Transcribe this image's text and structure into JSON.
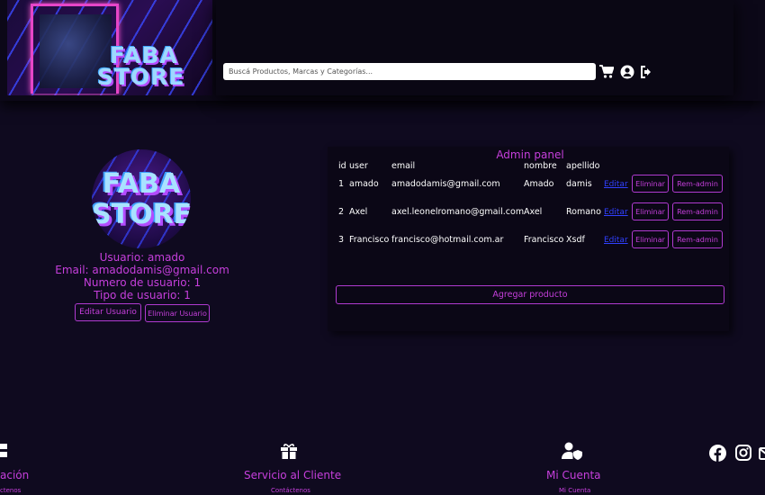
{
  "header": {
    "logo_text_line1": "FABA",
    "logo_text_line2": "STORE",
    "search_placeholder": "Buscá Productos, Marcas y Categorías...",
    "icons": [
      "cart-icon",
      "user-circle-icon",
      "logout-icon"
    ]
  },
  "profile": {
    "avatar_text_line1": "FABA",
    "avatar_text_line2": "STORE",
    "usuario": "Usuario: amado",
    "email": "Email: amadodamis@gmail.com",
    "numero": "Numero de usuario: 1",
    "tipo": "Tipo de usuario: 1",
    "edit_button": "Editar Usuario",
    "delete_button": "Eliminar Usuario"
  },
  "admin": {
    "title": "Admin panel",
    "columns": [
      "id",
      "user",
      "email",
      "nombre",
      "apellido"
    ],
    "rows": [
      {
        "id": "1",
        "user": "amado",
        "email": "amadodamis@gmail.com",
        "nombre": "Amado",
        "apellido": "damis"
      },
      {
        "id": "2",
        "user": "Axel",
        "email": "axel.leonelromano@gmail.com",
        "nombre": "Axel",
        "apellido": "Romano"
      },
      {
        "id": "3",
        "user": "Francisco",
        "email": "francisco@hotmail.com.ar",
        "nombre": "Francisco",
        "apellido": "Xsdf"
      }
    ],
    "edit_label": "Editar",
    "delete_label": "Eliminar",
    "remadmin_label": "Rem-admin",
    "add_product": "Agregar producto"
  },
  "footer": {
    "col1_title": "ación",
    "col1_link": "ctenos",
    "col2_title": "Servicio al Cliente",
    "col2_link": "Contáctenos",
    "col3_title": "Mi Cuenta",
    "col3_link": "Mi Cuenta",
    "social_icons": [
      "facebook-icon",
      "instagram-icon",
      "mail-icon"
    ]
  },
  "colors": {
    "background": "#0f0a1f",
    "accent": "#c63fdc",
    "link": "#3040ff"
  }
}
